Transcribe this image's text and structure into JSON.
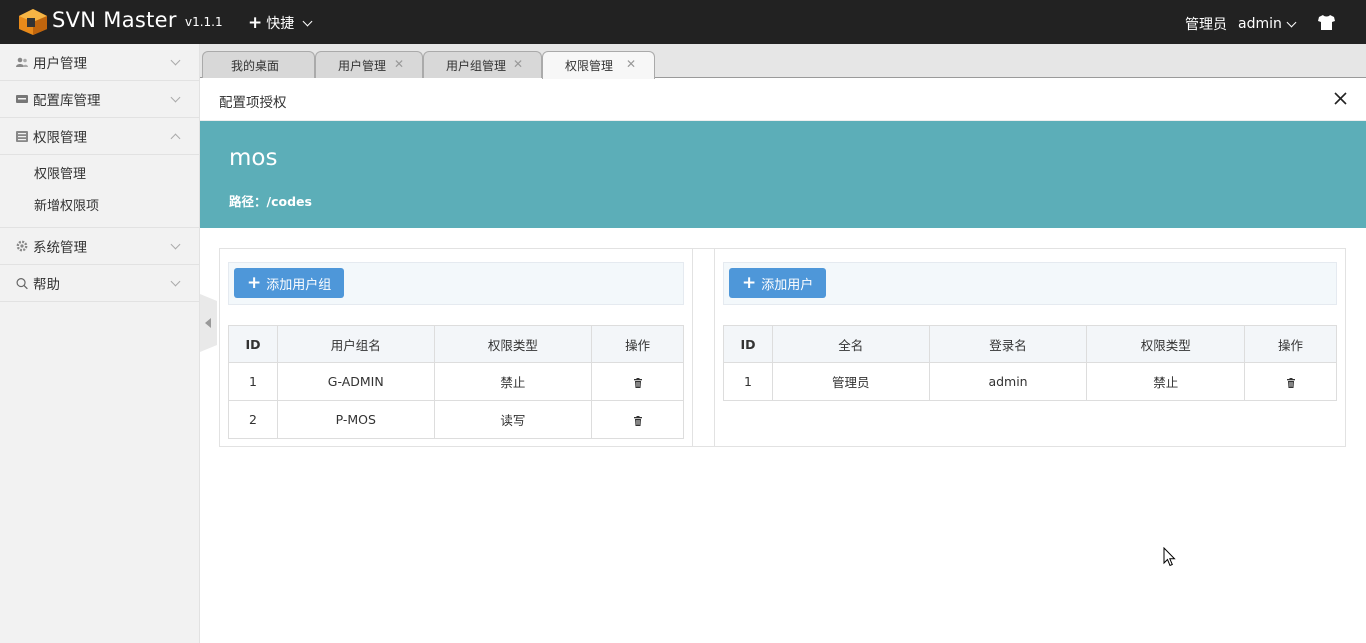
{
  "header": {
    "brand": "SVN Master",
    "version": "v1.1.1",
    "quick_label": "快捷",
    "user_role": "管理员",
    "username": "admin"
  },
  "sidebar": {
    "items": [
      {
        "label": "用户管理",
        "icon": "users-icon"
      },
      {
        "label": "配置库管理",
        "icon": "database-icon"
      },
      {
        "label": "权限管理",
        "icon": "list-icon",
        "expanded": true,
        "children": [
          "权限管理",
          "新增权限项"
        ]
      },
      {
        "label": "系统管理",
        "icon": "gear-icon"
      },
      {
        "label": "帮助",
        "icon": "search-icon"
      }
    ]
  },
  "tabs": [
    {
      "label": "我的桌面",
      "closable": false
    },
    {
      "label": "用户管理",
      "closable": true
    },
    {
      "label": "用户组管理",
      "closable": true
    },
    {
      "label": "权限管理",
      "closable": true,
      "active": true
    }
  ],
  "page": {
    "title": "配置项授权",
    "repo_name": "mos",
    "path_label": "路径：/codes"
  },
  "groups_panel": {
    "add_button": "添加用户组",
    "columns": [
      "ID",
      "用户组名",
      "权限类型",
      "操作"
    ],
    "rows": [
      {
        "id": "1",
        "name": "G-ADMIN",
        "permission": "禁止"
      },
      {
        "id": "2",
        "name": "P-MOS",
        "permission": "读写"
      }
    ]
  },
  "users_panel": {
    "add_button": "添加用户",
    "columns": [
      "ID",
      "全名",
      "登录名",
      "权限类型",
      "操作"
    ],
    "rows": [
      {
        "id": "1",
        "fullname": "管理员",
        "login": "admin",
        "permission": "禁止"
      }
    ]
  },
  "colors": {
    "topbar": "#222222",
    "banner": "#5caeb8",
    "button": "#4e97d9"
  }
}
